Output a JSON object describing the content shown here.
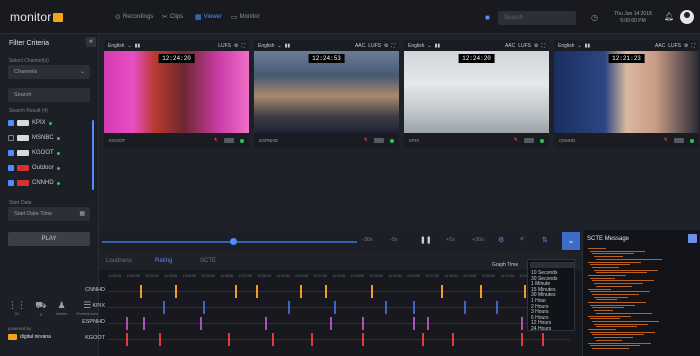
{
  "header": {
    "logo": "monitor",
    "tabs": [
      {
        "label": "Recordings",
        "icon": "record-icon"
      },
      {
        "label": "Clips",
        "icon": "scissors-icon"
      },
      {
        "label": "Viewer",
        "icon": "grid-icon",
        "active": true
      },
      {
        "label": "Monitor",
        "icon": "monitor-icon"
      }
    ],
    "search_placeholder": "Search",
    "datetime_line1": "Thu Jun 14 2018",
    "datetime_line2": "5:00:00 PM"
  },
  "sidebar": {
    "title": "Filter Criteria",
    "select_channels_label": "Select Channel(s)",
    "channels_placeholder": "Channels",
    "search_placeholder": "Search",
    "search_results_label": "Search Result (4)",
    "channels": [
      {
        "name": "KPIX",
        "checked": true,
        "logo_color": "#d9d9d9"
      },
      {
        "name": "MSNBC",
        "checked": false,
        "logo_color": "#d9d9d9"
      },
      {
        "name": "KGOOT",
        "checked": true,
        "logo_color": "#d9d9d9"
      },
      {
        "name": "Outdoor",
        "checked": true,
        "logo_color": "#d43131"
      },
      {
        "name": "CNNHD",
        "checked": true,
        "logo_color": "#d43131"
      }
    ],
    "start_date_label": "Start Date",
    "start_date_placeholder": "Start Date Time",
    "play_label": "PLAY",
    "bottom_icons": [
      {
        "icon": "network-icon",
        "label": "Ch"
      },
      {
        "icon": "car-icon",
        "label": "Tr"
      },
      {
        "icon": "user-icon",
        "label": "Admin"
      },
      {
        "icon": "equalizer-icon",
        "label": "Preferences"
      }
    ],
    "powered_by": "powered by",
    "brand": "digital nirvana"
  },
  "tiles": [
    {
      "lang": "English",
      "cc": "CC",
      "audio": "",
      "ts": "12:24:20",
      "footer": "KGOOT",
      "bg": "linear-gradient(90deg,#d43bb0 0%,#e84ec4 20%,#b93a2f 35%,#6e2630 55%,#cc3ea9 80%,#f070c8 100%)"
    },
    {
      "lang": "English",
      "cc": "CC",
      "audio": "AAC",
      "ts": "12:24:53",
      "footer": "ESPNHD",
      "bg": "linear-gradient(180deg,#6c7d99 0%,#485872 30%,#a88a6c 55%,#3c3c46 80%,#1e2235 100%)"
    },
    {
      "lang": "English",
      "cc": "CC",
      "audio": "AAC",
      "ts": "12:24:20",
      "footer": "KPIX",
      "bg": "linear-gradient(180deg,#cfd5d9 0%,#e4e8ea 40%,#b9c0c4 80%,#9aa2a8 100%)"
    },
    {
      "lang": "English",
      "cc": "CC",
      "audio": "AAC",
      "ts": "12:21:23",
      "footer": "CNNHD",
      "bg": "linear-gradient(90deg,#1b2f5e 0%,#2c4684 35%,#d9b8a0 50%,#c99c86 70%,#2a2a36 100%)"
    }
  ],
  "tile_controls": {
    "cc_label": "CC",
    "lufs_label": "LUFS"
  },
  "transport": {
    "controls": [
      "-30s",
      "-5s",
      "pause",
      "+5s",
      "+30s",
      "settings",
      "share",
      "skip"
    ]
  },
  "bottom_tabs": [
    {
      "label": "Loudness",
      "active": false
    },
    {
      "label": "Rating",
      "active": true
    },
    {
      "label": "SCTE",
      "active": false
    }
  ],
  "graph_time_label": "Graph Time",
  "graph_time_options": [
    "10 Seconds",
    "30 Seconds",
    "1 Minute",
    "15 Minutes",
    "30 Minutes",
    "1 Hour",
    "2 Hours",
    "3 Hours",
    "6 Hours",
    "12 Hours",
    "24 Hours"
  ],
  "timeline": {
    "ticks": [
      "12:00:00",
      "12:01:00",
      "12:02:00",
      "12:03:00",
      "12:04:00",
      "12:05:00",
      "12:06:00",
      "12:07:00",
      "12:08:00",
      "12:09:00",
      "12:10:00",
      "12:11:00",
      "12:12:00",
      "12:13:00",
      "12:14:00",
      "12:15:00",
      "12:16:00",
      "12:17:00",
      "12:18:00",
      "12:19:00",
      "12:20:00",
      "12:21:00",
      "12:22:00",
      "12:23:00",
      "12:24:00"
    ],
    "rows": [
      {
        "name": "CNNHD",
        "color": "#f39a2b",
        "marks": [
          0.07,
          0.145,
          0.275,
          0.32,
          0.415,
          0.47,
          0.57,
          0.72,
          0.805,
          0.9
        ]
      },
      {
        "name": "KPIX",
        "color": "#3f64c9",
        "marks": [
          0.12,
          0.205,
          0.39,
          0.49,
          0.6,
          0.66,
          0.77,
          0.84,
          0.96
        ]
      },
      {
        "name": "ESPNHD",
        "color": "#b04fb8",
        "marks": [
          0.04,
          0.075,
          0.2,
          0.34,
          0.48,
          0.55,
          0.66,
          0.69,
          0.895
        ]
      },
      {
        "name": "KGOOT",
        "color": "#e23a3a",
        "marks": [
          0.04,
          0.11,
          0.26,
          0.355,
          0.44,
          0.55,
          0.68,
          0.745,
          0.895,
          0.94
        ]
      }
    ]
  },
  "scte": {
    "title": "SCTE Message"
  }
}
